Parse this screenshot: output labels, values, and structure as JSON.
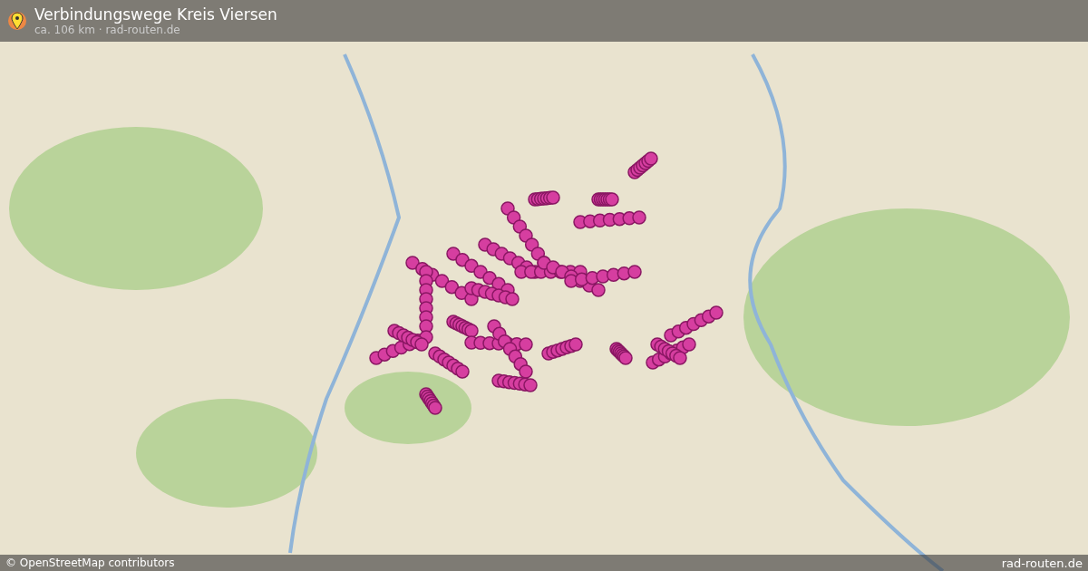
{
  "header": {
    "title": "Verbindungswege Kreis Viersen",
    "subtitle": "ca. 106 km · rad-routen.de"
  },
  "footer": {
    "attribution": "© OpenStreetMap contributors",
    "site": "rad-routen.de"
  }
}
